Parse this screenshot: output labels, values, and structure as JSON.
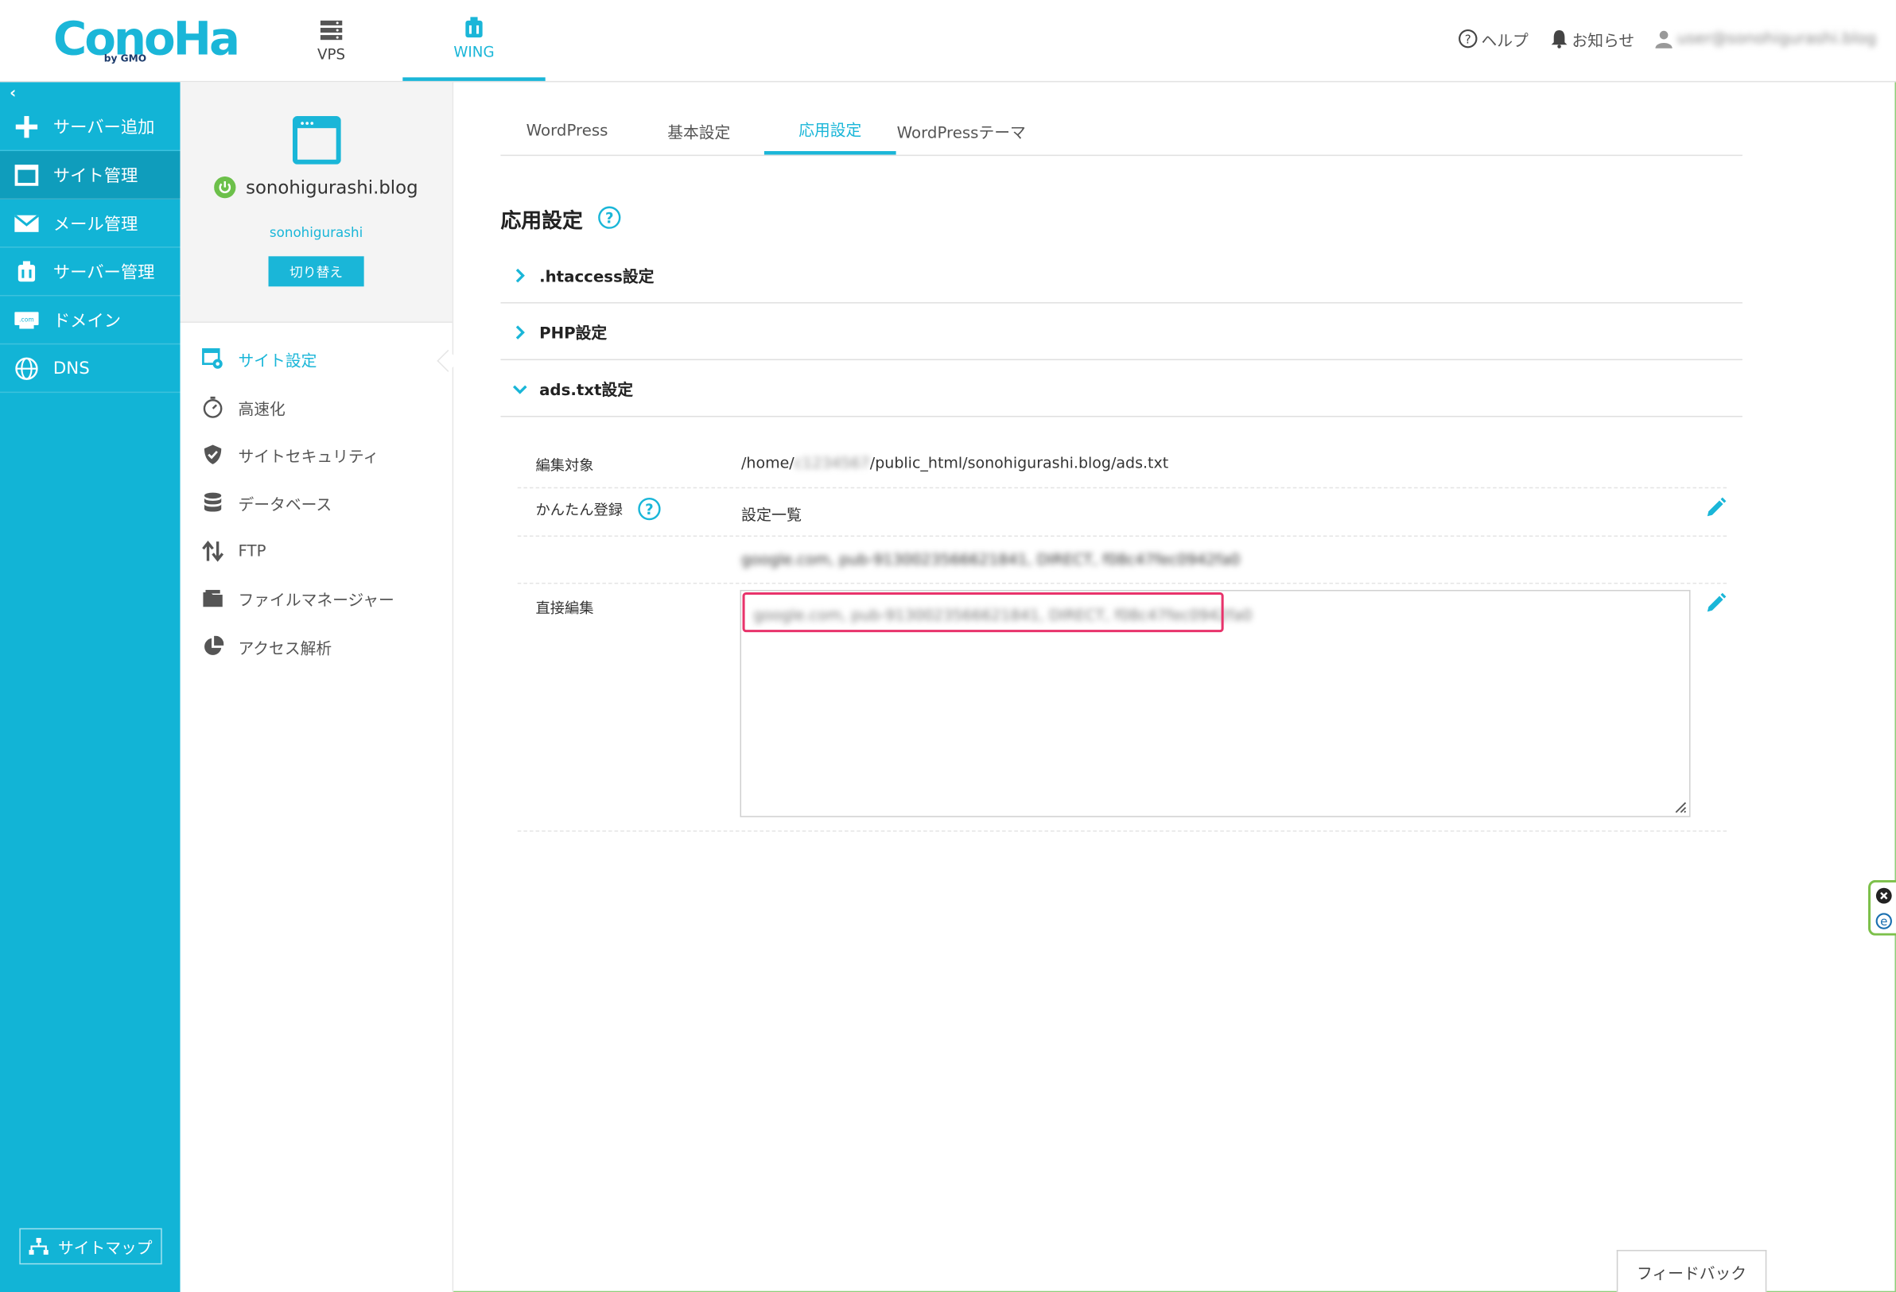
{
  "header": {
    "logo_text": "ConoHa",
    "logo_sub": "by GMO",
    "nav": [
      {
        "label": "VPS",
        "active": false
      },
      {
        "label": "WING",
        "active": true
      }
    ],
    "help_label": "ヘルプ",
    "notice_label": "お知らせ",
    "user_account": "user@sonohigurashi.blog"
  },
  "sidebar": {
    "items": [
      {
        "label": "サーバー追加",
        "icon": "plus-icon"
      },
      {
        "label": "サイト管理",
        "icon": "window-icon",
        "active": true
      },
      {
        "label": "メール管理",
        "icon": "mail-icon"
      },
      {
        "label": "サーバー管理",
        "icon": "server-icon"
      },
      {
        "label": "ドメイン",
        "icon": "domain-icon"
      },
      {
        "label": "DNS",
        "icon": "globe-icon"
      }
    ],
    "sitemap_label": "サイトマップ"
  },
  "site": {
    "domain": "sonohigurashi.blog",
    "user": "sonohigurashi",
    "switch_label": "切り替え"
  },
  "site_menu": [
    {
      "label": "サイト設定",
      "icon": "site-settings-icon",
      "active": true
    },
    {
      "label": "高速化",
      "icon": "stopwatch-icon"
    },
    {
      "label": "サイトセキュリティ",
      "icon": "shield-icon"
    },
    {
      "label": "データベース",
      "icon": "database-icon"
    },
    {
      "label": "FTP",
      "icon": "transfer-icon"
    },
    {
      "label": "ファイルマネージャー",
      "icon": "folder-icon"
    },
    {
      "label": "アクセス解析",
      "icon": "pie-chart-icon"
    }
  ],
  "tabs": [
    {
      "label": "WordPress"
    },
    {
      "label": "基本設定"
    },
    {
      "label": "応用設定",
      "active": true
    },
    {
      "label": "WordPressテーマ"
    }
  ],
  "page_title": "応用設定",
  "accordions": [
    {
      "label": ".htaccess設定",
      "expanded": false
    },
    {
      "label": "PHP設定",
      "expanded": false
    },
    {
      "label": "ads.txt設定",
      "expanded": true
    }
  ],
  "ads": {
    "target_label": "編集対象",
    "path_prefix": "/home/",
    "path_hidden": "c1234567",
    "path_suffix": "/public_html/sonohigurashi.blog/ads.txt",
    "easy_label": "かんたん登録",
    "list_label": "設定一覧",
    "entry_blurred": "google.com, pub-9130023566621841, DIRECT, f08c47fec0942fa0",
    "direct_label": "直接編集",
    "textarea_blurred": "google.com, pub-9130023566621841, DIRECT, f08c47fec0942fa0"
  },
  "feedback_label": "フィードバック",
  "colors": {
    "accent": "#1ab6d8",
    "highlight": "#e8336b",
    "power": "#6cc04a"
  }
}
